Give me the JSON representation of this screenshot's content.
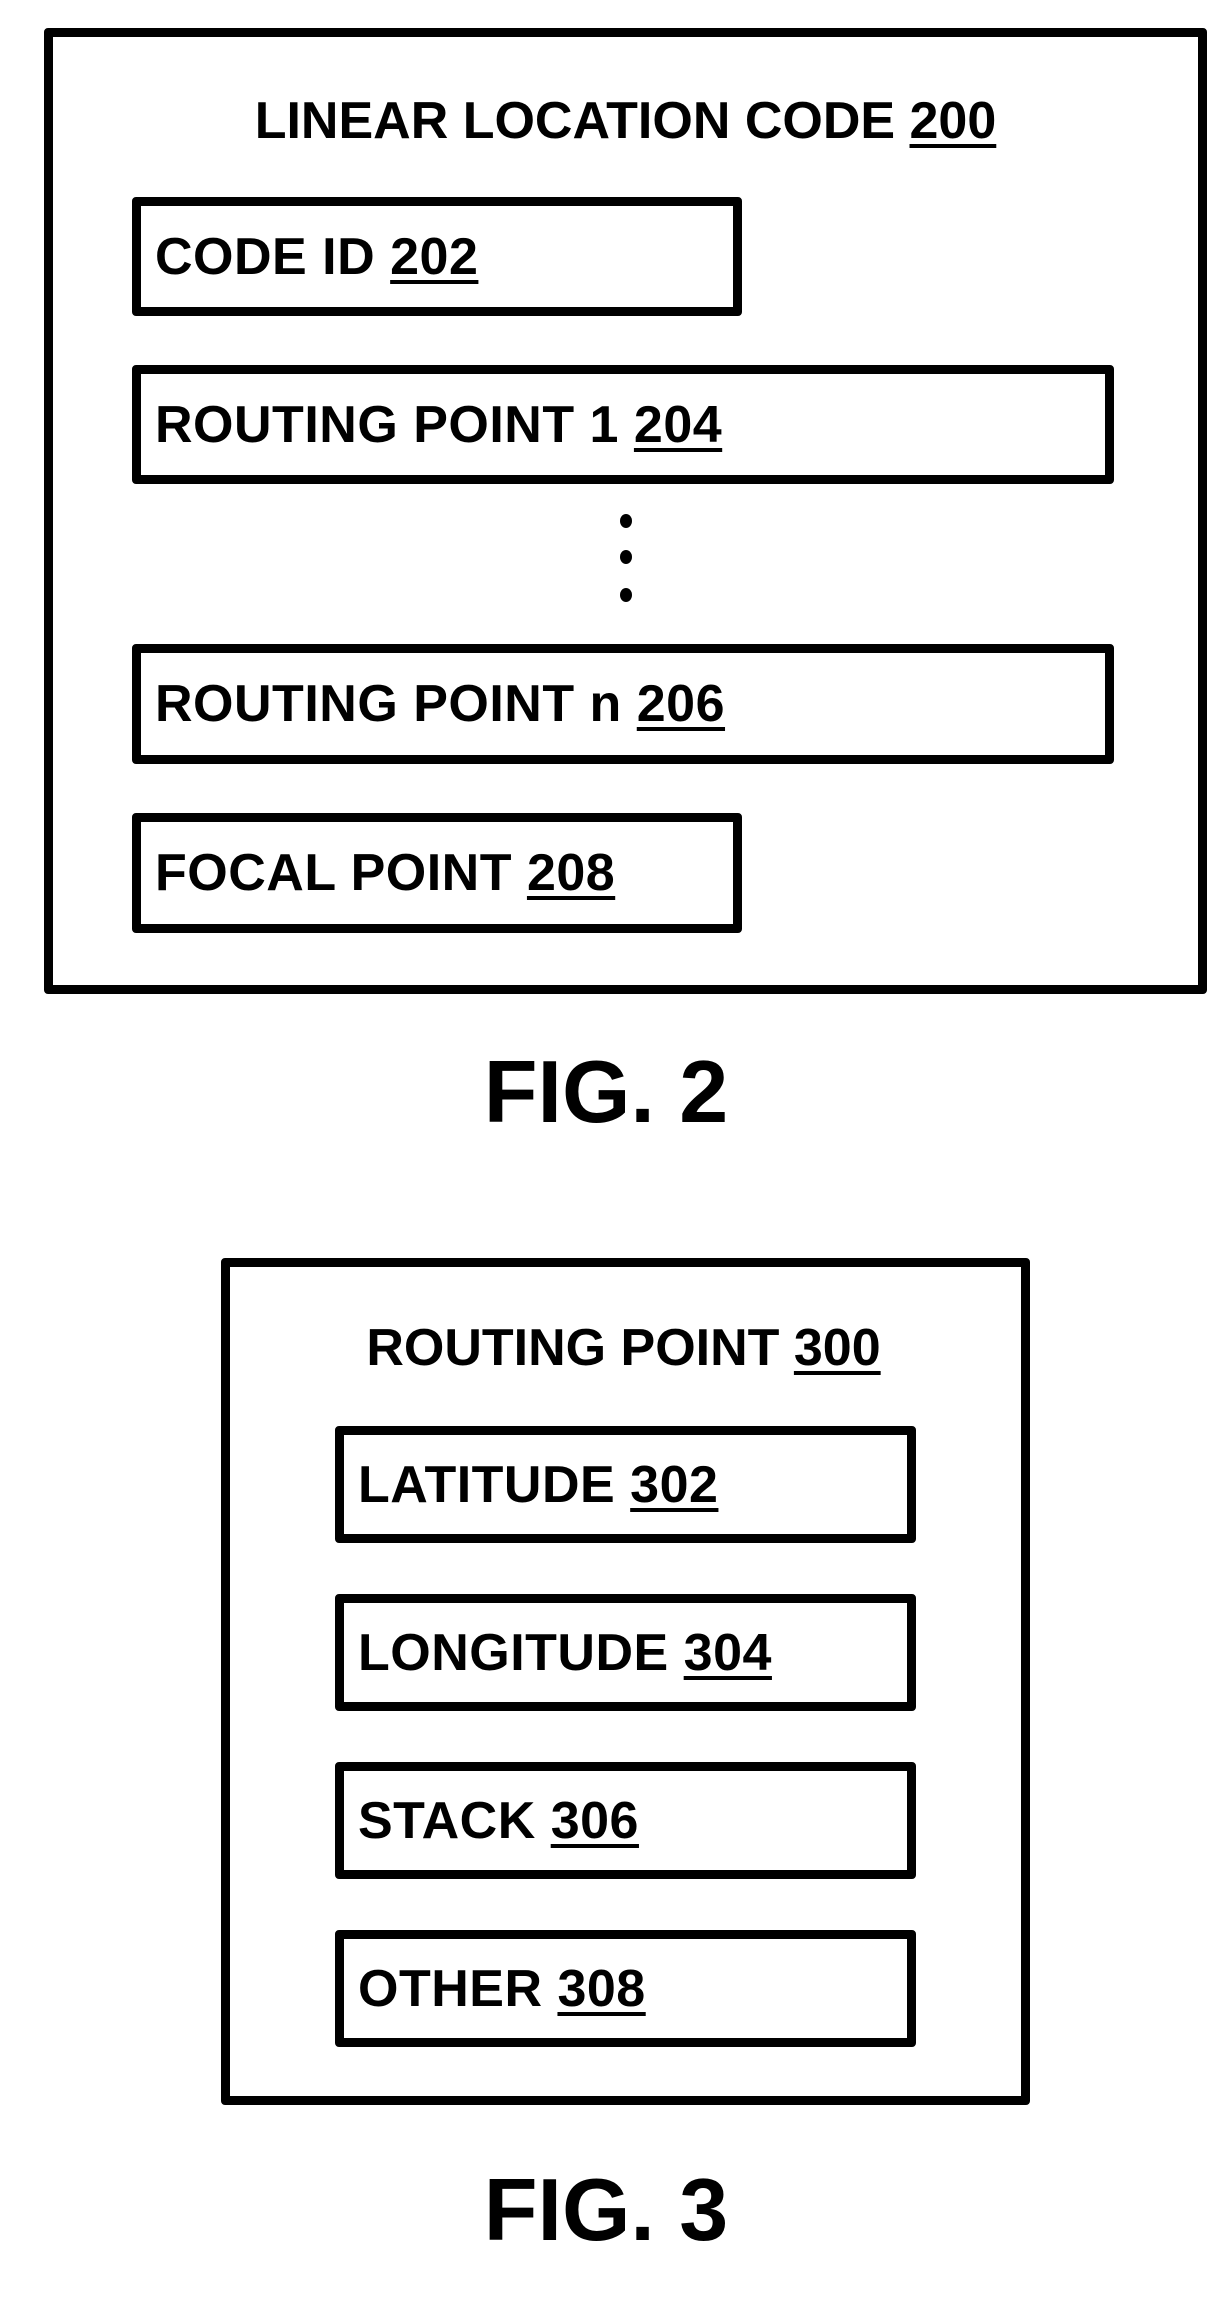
{
  "fig2": {
    "title": {
      "text": "LINEAR LOCATION CODE ",
      "ref": "200"
    },
    "fields": [
      {
        "text": "CODE ID ",
        "ref": "202"
      },
      {
        "text": "ROUTING POINT 1 ",
        "ref": "204"
      },
      {
        "text": "ROUTING POINT n ",
        "ref": "206"
      },
      {
        "text": "FOCAL POINT ",
        "ref": "208"
      }
    ],
    "ellipsis": "vertical-ellipsis",
    "caption": "FIG. 2"
  },
  "fig3": {
    "title": {
      "text": "ROUTING POINT ",
      "ref": "300"
    },
    "fields": [
      {
        "text": "LATITUDE ",
        "ref": "302"
      },
      {
        "text": "LONGITUDE ",
        "ref": "304"
      },
      {
        "text": "STACK ",
        "ref": "306"
      },
      {
        "text": "OTHER ",
        "ref": "308"
      }
    ],
    "caption": "FIG. 3"
  }
}
